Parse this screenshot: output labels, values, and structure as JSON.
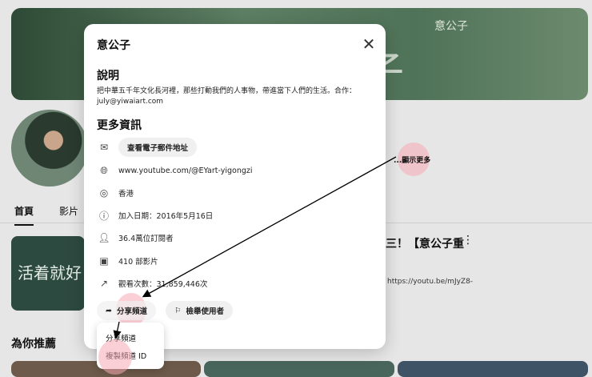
{
  "page": {
    "tabs": [
      "首頁",
      "影片"
    ],
    "video_title": "三！【意公子重",
    "video_desc": "https://youtu.be/mJyZ8-",
    "show_more": "...顯示更多",
    "recommended": "為你推薦",
    "thumb_text": "活着就好"
  },
  "banner": {
    "logo": "意公子",
    "text": "子"
  },
  "modal": {
    "title": "意公子",
    "desc_heading": "說明",
    "description": "把中華五千年文化長河裡，那些打動我們的人事物，帶進當下人們的生活。合作：july@yiwaiart.com",
    "more_heading": "更多資訊",
    "email_button": "查看電子郵件地址",
    "url": "www.youtube.com/@EYart-yigongzi",
    "location": "香港",
    "joined": "加入日期：2016年5月16日",
    "subscribers": "36.4萬位訂閱者",
    "videos": "410 部影片",
    "views": "觀看次數：31,859,446次",
    "share_button": "分享頻道",
    "report_button": "檢舉使用者"
  },
  "menu": {
    "items": [
      "分享頻道",
      "複製頻道 ID"
    ]
  }
}
